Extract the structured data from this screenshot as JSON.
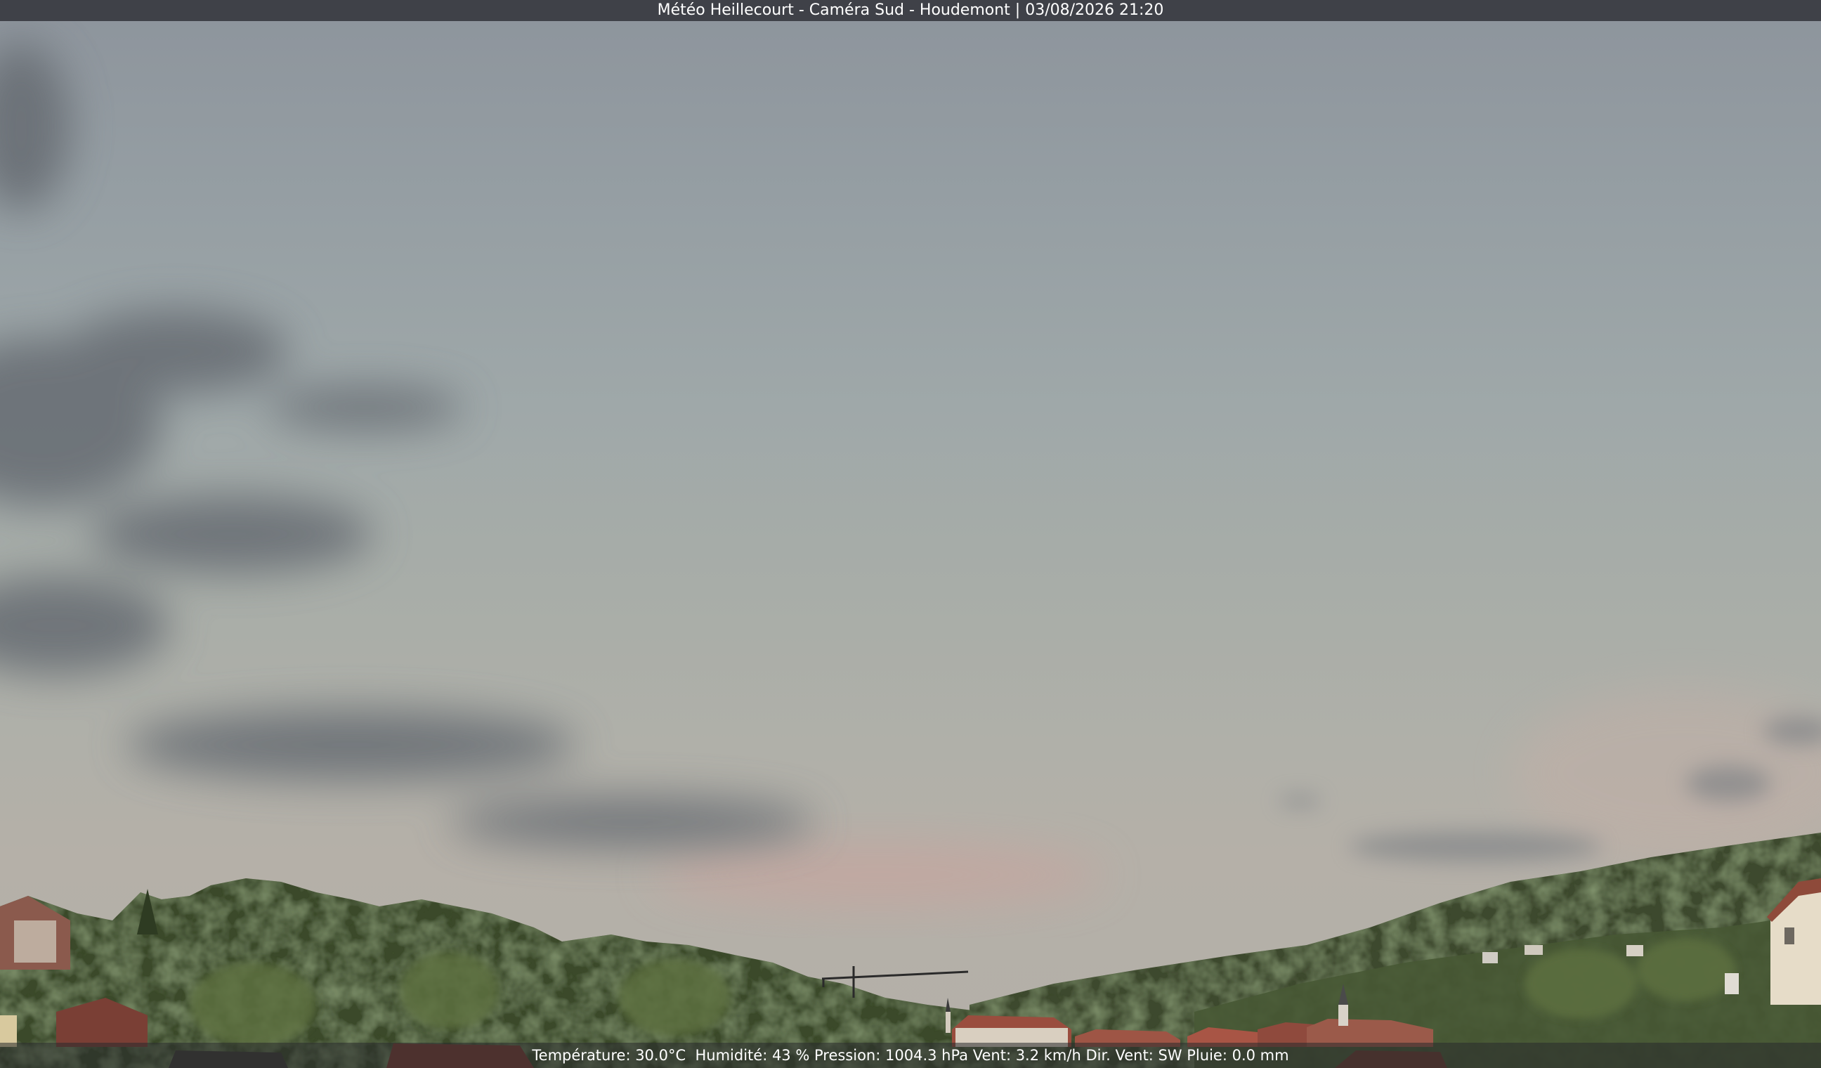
{
  "overlay": {
    "title": "Météo Heillecourt - Caméra Sud - Houdemont | 03/08/2026 21:20",
    "weather": {
      "temperature": "Température: 30.0°C",
      "humidity": "Humidité: 43 %",
      "pressure": "Pression: 1004.3 hPa",
      "wind": "Vent: 3.2 km/h",
      "wind_dir": "Dir. Vent: SW",
      "rain": "Pluie: 0.0 mm"
    }
  },
  "scene": {
    "description_icon": "landscape-icon",
    "colors": {
      "sky_top": "#8d949c",
      "sky_horizon": "#b5b0a8",
      "sunset_glow": "#c9a8a0",
      "clouds": "#6e7378",
      "trees_dark": "#2f3b24",
      "trees_light": "#5a6e3e",
      "roofs": "#8a4a3a"
    }
  }
}
